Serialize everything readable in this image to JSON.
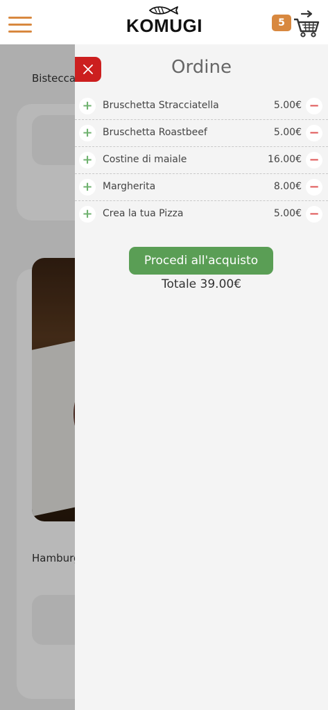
{
  "header": {
    "logo_text": "KOMUGI",
    "cart_count": "5"
  },
  "background": {
    "label_top": "Bistecca",
    "label_bottom": "Hamburg"
  },
  "order": {
    "title": "Ordine",
    "items": [
      {
        "name": "Bruschetta Stracciatella",
        "price": "5.00€"
      },
      {
        "name": "Bruschetta Roastbeef",
        "price": "5.00€"
      },
      {
        "name": "Costine di maiale",
        "price": "16.00€"
      },
      {
        "name": "Margherita",
        "price": "8.00€"
      },
      {
        "name": "Crea la tua Pizza",
        "price": "5.00€"
      }
    ],
    "plus_symbol": "+",
    "minus_symbol": "−",
    "checkout_label": "Procedi all'acquisto",
    "total_label": "Totale 39.00€"
  },
  "icons": {
    "menu": "hamburger-menu-icon",
    "cart": "cart-icon",
    "close": "close-icon",
    "logo": "fish-icon"
  },
  "colors": {
    "accent": "#d8883f",
    "close": "#cc1f1f",
    "checkout": "#5a9e55",
    "plus": "#6fb26f",
    "minus": "#e05a5a"
  }
}
